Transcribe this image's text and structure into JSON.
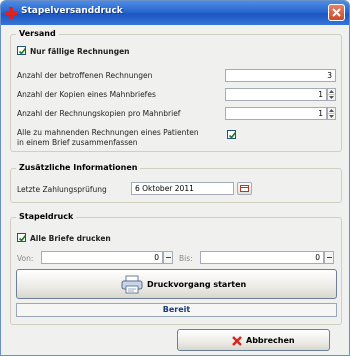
{
  "window": {
    "title": "Stapelversanddruck"
  },
  "versand": {
    "title": "Versand",
    "only_due_label": "Nur fällige Rechnungen",
    "only_due_checked": true,
    "affected_label": "Anzahl der betroffenen Rechnungen",
    "affected_value": "3",
    "copies_label": "Anzahl der Kopien eines Mahnbriefes",
    "copies_value": "1",
    "invoice_copies_label": "Anzahl der Rechnungskopien pro Mahnbrief",
    "invoice_copies_value": "1",
    "combine_label_line1": "Alle zu mahnenden Rechnungen eines Patienten",
    "combine_label_line2": "in einem Brief zusammenfassen",
    "combine_checked": true
  },
  "zusatz": {
    "title": "Zusätzliche Informationen",
    "last_payment_label": "Letzte Zahlungsprüfung",
    "last_payment_value": "6 Oktober 2011"
  },
  "stapel": {
    "title": "Stapeldruck",
    "all_letters_label": "Alle Briefe drucken",
    "all_letters_checked": true,
    "from_label": "Von:",
    "from_value": "0",
    "to_label": "Bis:",
    "to_value": "0",
    "start_label": "Druckvorgang starten",
    "status_text": "Bereit"
  },
  "footer": {
    "cancel_label": "Abbrechen"
  },
  "colors": {
    "titlebar": "#2a66cf",
    "accent": "#1c3a7a",
    "cancel_icon": "#d7261e"
  }
}
